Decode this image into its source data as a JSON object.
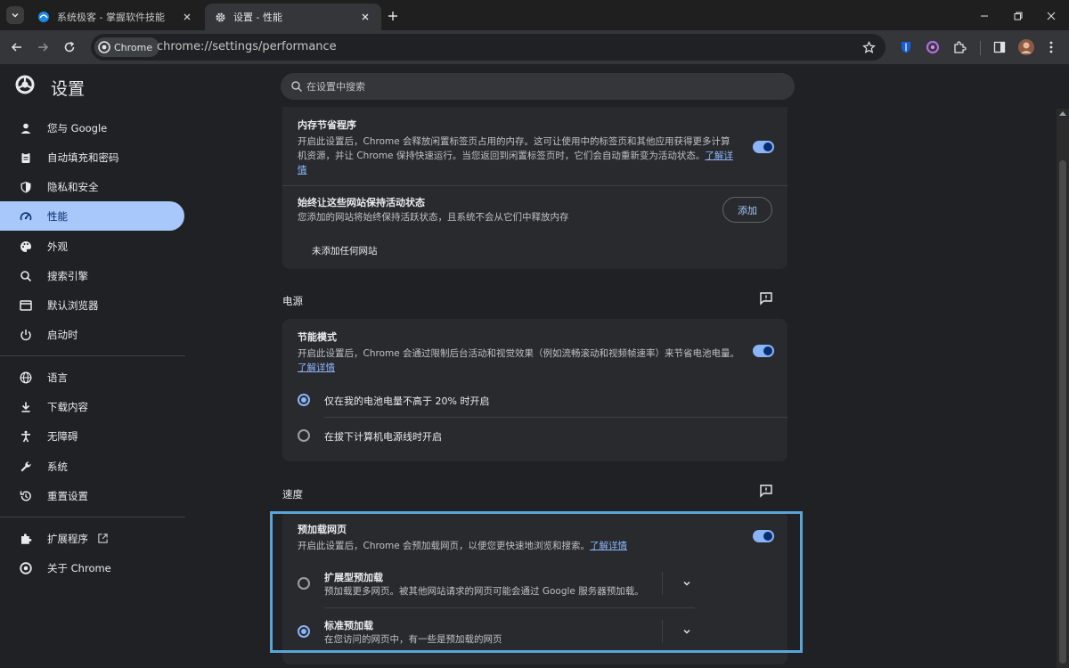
{
  "browser": {
    "tabs": [
      {
        "title": "系统极客 - 掌握软件技能",
        "active": false
      },
      {
        "title": "设置 - 性能",
        "active": true
      }
    ],
    "chip_label": "Chrome",
    "url": "chrome://settings/performance"
  },
  "settings": {
    "title": "设置",
    "search_placeholder": "在设置中搜索"
  },
  "sidebar": {
    "items": [
      {
        "label": "您与 Google",
        "icon": "person-icon"
      },
      {
        "label": "自动填充和密码",
        "icon": "clipboard-icon"
      },
      {
        "label": "隐私和安全",
        "icon": "shield-icon"
      },
      {
        "label": "性能",
        "icon": "speedometer-icon",
        "active": true
      },
      {
        "label": "外观",
        "icon": "palette-icon"
      },
      {
        "label": "搜索引擎",
        "icon": "search-icon"
      },
      {
        "label": "默认浏览器",
        "icon": "browser-icon"
      },
      {
        "label": "启动时",
        "icon": "power-icon"
      },
      {
        "label": "语言",
        "icon": "globe-icon"
      },
      {
        "label": "下载内容",
        "icon": "download-icon"
      },
      {
        "label": "无障碍",
        "icon": "accessibility-icon"
      },
      {
        "label": "系统",
        "icon": "wrench-icon"
      },
      {
        "label": "重置设置",
        "icon": "reset-icon"
      },
      {
        "label": "扩展程序",
        "icon": "puzzle-icon"
      },
      {
        "label": "关于 Chrome",
        "icon": "chrome-icon"
      }
    ]
  },
  "memory": {
    "title": "内存节省程序",
    "desc": "开启此设置后，Chrome 会释放闲置标签页占用的内存。这可让使用中的标签页和其他应用获得更多计算机资源，并让 Chrome 保持快速运行。当您返回到闲置标签页时，它们会自动重新变为活动状态。",
    "link": "了解详情",
    "enabled": true,
    "keep_title": "始终让这些网站保持活动状态",
    "keep_desc": "您添加的网站将始终保持活跃状态，且系统不会从它们中释放内存",
    "add_label": "添加",
    "empty_label": "未添加任何网站"
  },
  "power": {
    "section": "电源",
    "title": "节能模式",
    "desc": "开启此设置后，Chrome 会通过限制后台活动和视觉效果（例如流畅滚动和视频帧速率）来节省电池电量。",
    "link": "了解详情",
    "enabled": true,
    "options": [
      {
        "label": "仅在我的电池电量不高于 20% 时开启",
        "checked": true
      },
      {
        "label": "在拔下计算机电源线时开启",
        "checked": false
      }
    ]
  },
  "speed": {
    "section": "速度",
    "title": "预加载网页",
    "desc": "开启此设置后，Chrome 会预加载网页，以便您更快速地浏览和搜索。",
    "link": "了解详情",
    "enabled": true,
    "options": [
      {
        "title": "扩展型预加载",
        "desc": "预加载更多网页。被其他网站请求的网页可能会通过 Google 服务器预加载。",
        "checked": false
      },
      {
        "title": "标准预加载",
        "desc": "在您访问的网页中，有一些是预加载的网页",
        "checked": true
      }
    ]
  },
  "colors": {
    "accent": "#8ab4f8",
    "active_nav": "#a8c7fa",
    "highlight_box": "#5ba4d9"
  }
}
